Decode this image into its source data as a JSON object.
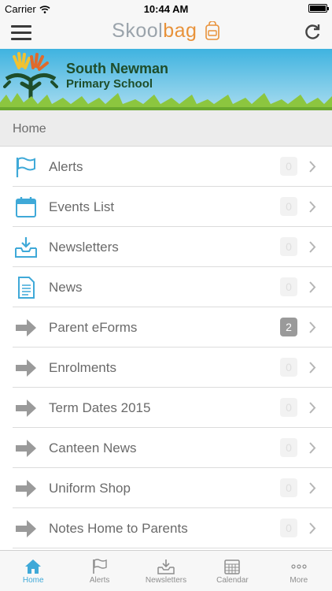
{
  "status_bar": {
    "carrier": "Carrier",
    "time": "10:44 AM"
  },
  "header": {
    "brand_part1": "Skool",
    "brand_part2": "bag"
  },
  "banner": {
    "line1": "South Newman",
    "line2": "Primary School"
  },
  "section": {
    "title": "Home"
  },
  "items": [
    {
      "label": "Alerts",
      "count": "0",
      "icon": "flag-icon"
    },
    {
      "label": "Events List",
      "count": "0",
      "icon": "calendar-icon"
    },
    {
      "label": "Newsletters",
      "count": "0",
      "icon": "inbox-download-icon"
    },
    {
      "label": "News",
      "count": "0",
      "icon": "document-icon"
    },
    {
      "label": "Parent eForms",
      "count": "2",
      "icon": "arrow-right-icon"
    },
    {
      "label": "Enrolments",
      "count": "0",
      "icon": "arrow-right-icon"
    },
    {
      "label": "Term Dates 2015",
      "count": "0",
      "icon": "arrow-right-icon"
    },
    {
      "label": "Canteen News",
      "count": "0",
      "icon": "arrow-right-icon"
    },
    {
      "label": "Uniform Shop",
      "count": "0",
      "icon": "arrow-right-icon"
    },
    {
      "label": "Notes Home to Parents",
      "count": "0",
      "icon": "arrow-right-icon"
    }
  ],
  "tabs": [
    {
      "label": "Home",
      "icon": "home-icon",
      "active": true
    },
    {
      "label": "Alerts",
      "icon": "flag-icon"
    },
    {
      "label": "Newsletters",
      "icon": "inbox-download-icon"
    },
    {
      "label": "Calendar",
      "icon": "calendar-icon"
    },
    {
      "label": "More",
      "icon": "ellipsis-icon"
    }
  ],
  "colors": {
    "accent": "#3fa9d8",
    "brand_orange": "#e8923a",
    "badge_active": "#9a9a9a"
  }
}
